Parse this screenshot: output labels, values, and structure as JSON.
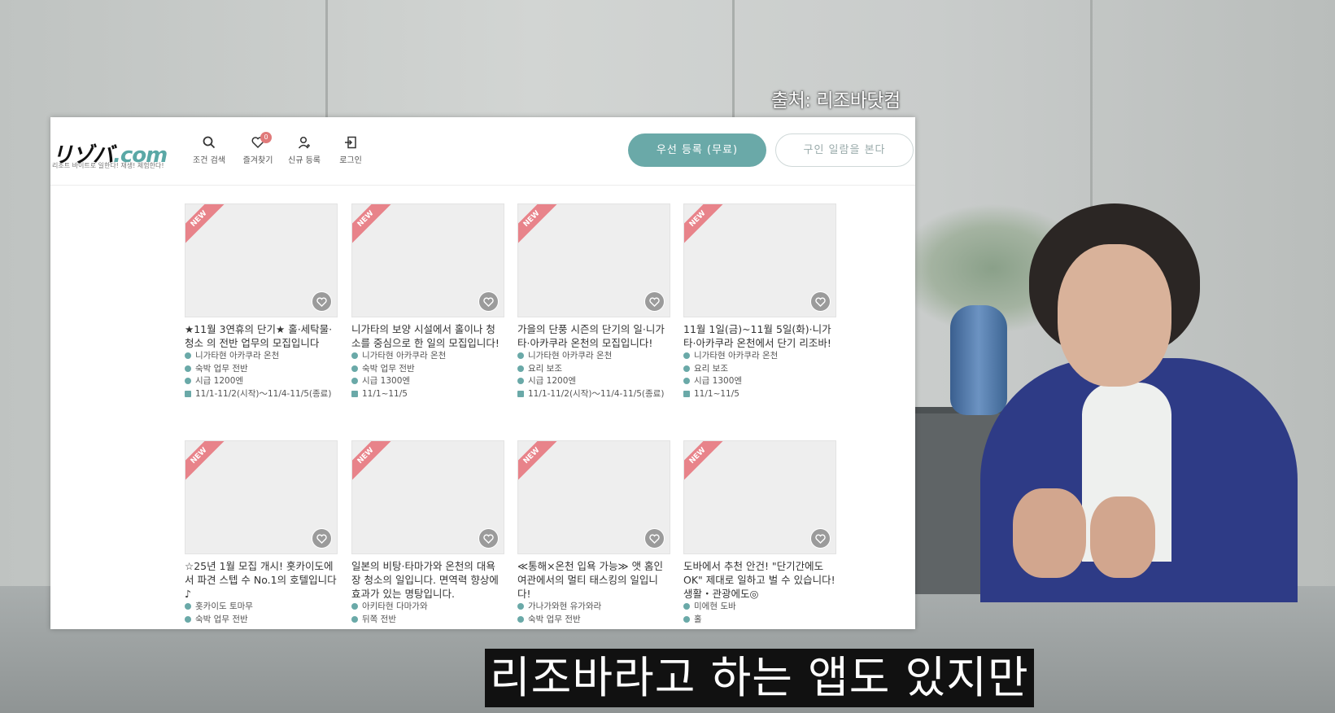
{
  "video": {
    "source_label": "출처: 리조바닷컴",
    "subtitle": "리조바라고 하는 앱도 있지만"
  },
  "site": {
    "logo_main": "リゾバ",
    "logo_suffix": ".com",
    "tagline": "리조트 바이트로 일한다! 재생! 체험한다!",
    "nav": [
      {
        "label": "조건 검색",
        "icon": "search-icon"
      },
      {
        "label": "즐겨찾기",
        "icon": "heart-icon",
        "badge": "0"
      },
      {
        "label": "신규 등록",
        "icon": "user-icon"
      },
      {
        "label": "로그인",
        "icon": "login-icon"
      }
    ],
    "primary_button": "우선 등록 (무료)",
    "secondary_button": "구인 일람을 본다",
    "new_label": "NEW",
    "cards": [
      {
        "title": "★11월 3연휴의 단기★ 홀·세탁물·청소 의 전반 업무의 모집입니다",
        "location": "니가타현 아카쿠라 온천",
        "job": "숙박 업무 전반",
        "wage": "시급 1200엔",
        "period": "11/1-11/2(시작)〜11/4-11/5(종료)",
        "img": "img-hotel"
      },
      {
        "title": "니가타의 보양 시설에서 홀이나 청소를 중심으로 한 일의 모집입니다!",
        "location": "니가타현 아카쿠라 온천",
        "job": "숙박 업무 전반",
        "wage": "시급 1300엔",
        "period": "11/1~11/5",
        "img": "img-track"
      },
      {
        "title": "가을의 단풍 시즌의 단기의 일·니가타·아카쿠라 온천의 모집입니다!",
        "location": "니가타현 아카쿠라 온천",
        "job": "요리 보조",
        "wage": "시급 1200엔",
        "period": "11/1-11/2(시작)〜11/4-11/5(종료)",
        "img": "img-bath"
      },
      {
        "title": "11월 1일(금)~11월 5일(화)·니가타·아카쿠라 온천에서 단기 리조바!",
        "location": "니가타현 아카쿠라 온천",
        "job": "요리 보조",
        "wage": "시급 1300엔",
        "period": "11/1~11/5",
        "img": "img-hotel"
      },
      {
        "title": "☆25년 1월 모집 개시! 홋카이도에서 파견 스텝 수 No.1의 호텔입니다♪",
        "location": "홋카이도 토마무",
        "job": "숙박 업무 전반",
        "img": "img-ski"
      },
      {
        "title": "일본의 비탕·타마가와 온천의 대욕장 청소의 일입니다. 면역력 향상에 효과가 있는 명탕입니다.",
        "location": "아키타현 다마가와",
        "job": "뒤쪽 전반",
        "img": "img-wood"
      },
      {
        "title": "≪통해×온천 입욕 가능≫ 앳 홈인 여관에서의 멀티 태스킹의 일입니다!",
        "location": "가나가와현 유가와라",
        "job": "숙박 업무 전반",
        "img": "img-onsen"
      },
      {
        "title": "도바에서 추천 안건! \"단기간에도 OK\" 제대로 일하고 벌 수 있습니다! 생활・관광에도◎",
        "location": "미에현 도바",
        "job": "홀",
        "img": "img-swing"
      }
    ]
  }
}
